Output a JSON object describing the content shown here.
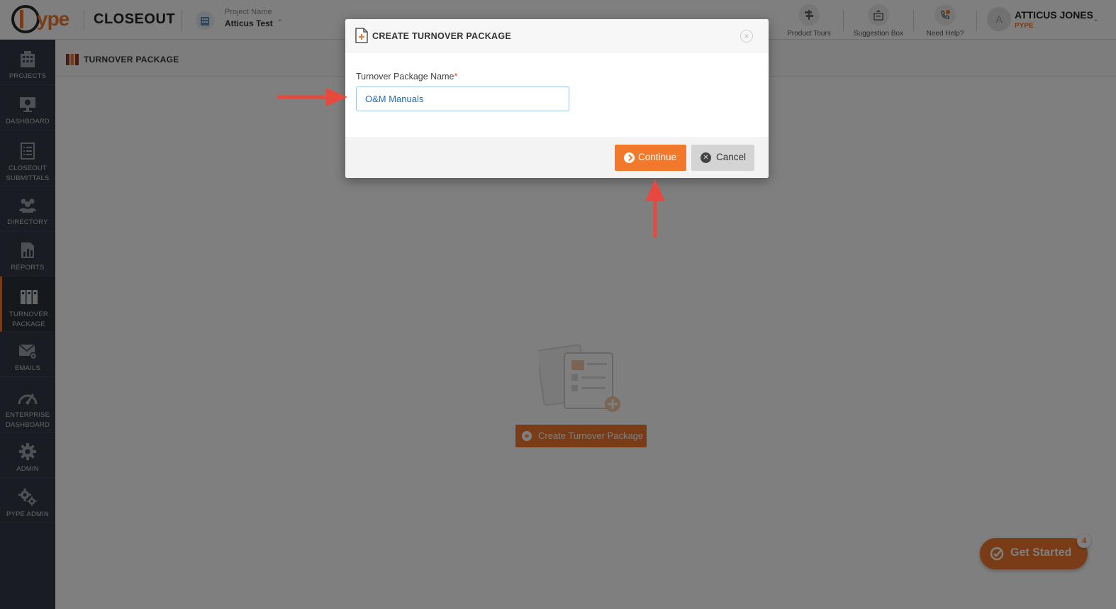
{
  "header": {
    "logo_text": "ype",
    "app_name": "CLOSEOUT",
    "project_label": "Project Name",
    "project_value": "Atticus Test",
    "tools": [
      {
        "label": "Product Tours",
        "icon": "signpost-icon"
      },
      {
        "label": "Suggestion Box",
        "icon": "suggestion-box-icon"
      },
      {
        "label": "Need Help?",
        "icon": "phone-help-icon"
      }
    ],
    "user_initial": "A",
    "user_name": "ATTICUS JONES",
    "user_org": "PYPE"
  },
  "sidebar": {
    "items": [
      {
        "line1": "PROJECTS",
        "line2": "",
        "icon": "building-icon"
      },
      {
        "line1": "DASHBOARD",
        "line2": "",
        "icon": "monitor-icon"
      },
      {
        "line1": "CLOSEOUT",
        "line2": "SUBMITTALS",
        "icon": "document-list-icon"
      },
      {
        "line1": "DIRECTORY",
        "line2": "",
        "icon": "people-icon"
      },
      {
        "line1": "REPORTS",
        "line2": "",
        "icon": "report-chart-icon"
      },
      {
        "line1": "TURNOVER",
        "line2": "PACKAGE",
        "icon": "binders-icon",
        "active": true
      },
      {
        "line1": "EMAILS",
        "line2": "",
        "icon": "email-gear-icon"
      },
      {
        "line1": "ENTERPRISE",
        "line2": "DASHBOARD",
        "icon": "speedometer-icon"
      },
      {
        "line1": "ADMIN",
        "line2": "",
        "icon": "gear-icon"
      },
      {
        "line1": "PYPE ADMIN",
        "line2": "",
        "icon": "gears-icon"
      }
    ]
  },
  "page": {
    "title": "TURNOVER PACKAGE",
    "create_button": "Create Turnover Package"
  },
  "get_started": {
    "label": "Get Started",
    "badge": "4"
  },
  "modal": {
    "title": "CREATE TURNOVER PACKAGE",
    "field_label": "Turnover Package Name",
    "required_mark": "*",
    "field_value": "O&M Manuals",
    "continue_label": "Continue",
    "cancel_label": "Cancel",
    "close_glyph": "×"
  },
  "colors": {
    "accent": "#f2792c",
    "sidebar_bg": "#333b47",
    "annotation_arrow": "#e8493f"
  }
}
